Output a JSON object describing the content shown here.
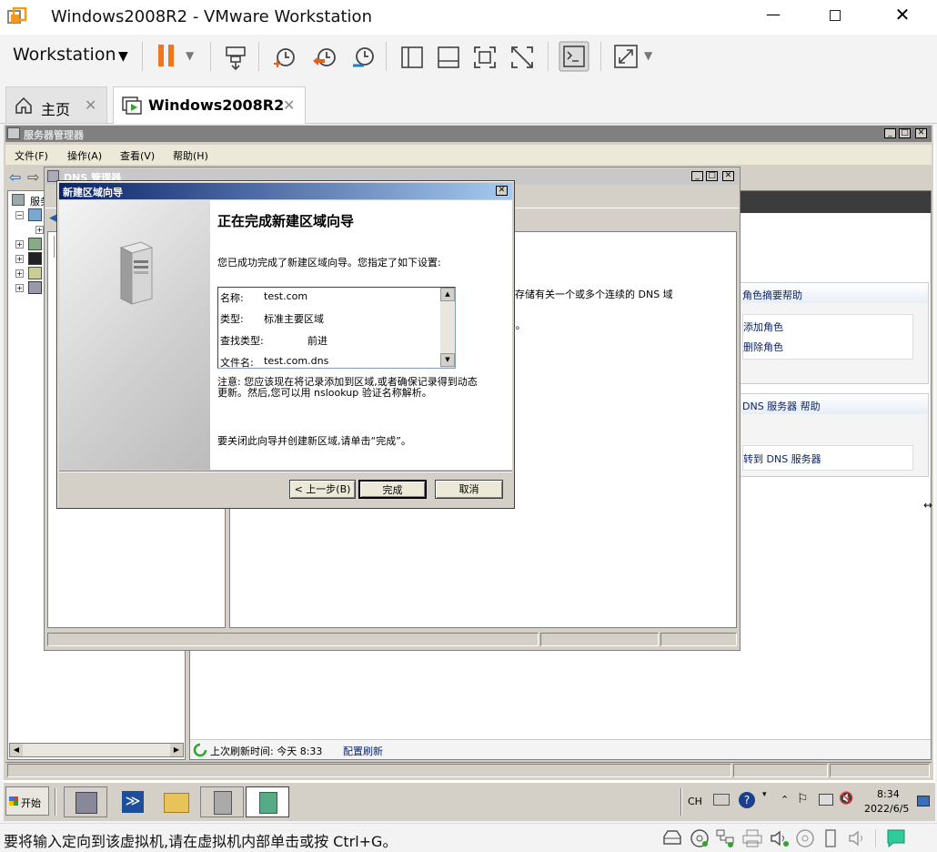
{
  "window": {
    "title": "Windows2008R2 - VMware Workstation"
  },
  "toolbar": {
    "workstation_label": "Workstation"
  },
  "tabs": [
    {
      "label": "主页"
    },
    {
      "label": "Windows2008R2"
    }
  ],
  "server_manager": {
    "title": "服务器管理器",
    "menu": [
      "文件(F)",
      "操作(A)",
      "查看(V)",
      "帮助(H)"
    ],
    "tree_root": "服务",
    "status_text": "上次刷新时间: 今天 8:33",
    "status_link": "配置刷新"
  },
  "dns_manager": {
    "title": "DNS 管理器",
    "desc_text": "域存储有关一个或多个连续的 DNS 域",
    "quote_tail": "”。"
  },
  "right_panel": {
    "section1_title": "角色摘要帮助",
    "add_role": "添加角色",
    "remove_role": "删除角色",
    "section2_title": "DNS 服务器 帮助",
    "goto_dns": "转到 DNS 服务器"
  },
  "wizard": {
    "title": "新建区域向导",
    "heading": "正在完成新建区域向导",
    "intro": "您已成功完成了新建区域向导。您指定了如下设置:",
    "settings": [
      {
        "label": "名称:",
        "value": "test.com"
      },
      {
        "label": "类型:",
        "value": "标准主要区域"
      },
      {
        "label": "查找类型:",
        "value": "前进"
      },
      {
        "label": "文件名:",
        "value": "test.com.dns"
      }
    ],
    "note": "注意: 您应该现在将记录添加到区域,或者确保记录得到动态更新。然后,您可以用 nslookup 验证名称解析。",
    "close_hint": "要关闭此向导并创建新区域,请单击“完成”。",
    "back_button": "< 上一步(B)",
    "finish_button": "完成",
    "cancel_button": "取消"
  },
  "taskbar": {
    "start_label": "开始",
    "lang": "CH",
    "clock_time": "8:34",
    "clock_date": "2022/6/5"
  },
  "vmware_status": {
    "hint": "要将输入定向到该虚拟机,请在虚拟机内部单击或按 Ctrl+G。"
  }
}
